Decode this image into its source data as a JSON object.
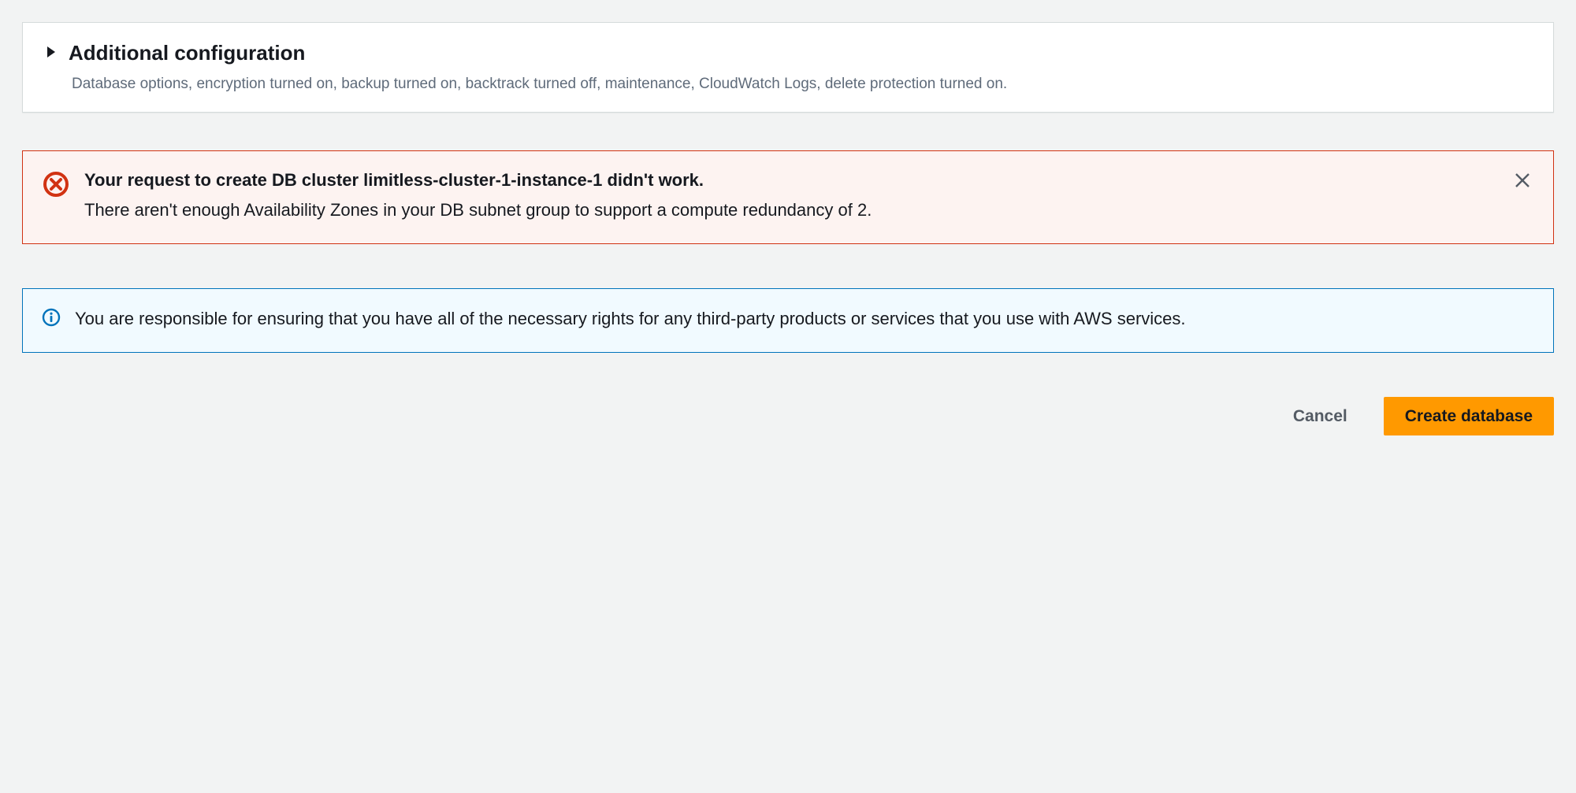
{
  "additional_config": {
    "title": "Additional configuration",
    "subtitle": "Database options, encryption turned on, backup turned on, backtrack turned off, maintenance, CloudWatch Logs, delete protection turned on."
  },
  "error_alert": {
    "title": "Your request to create DB cluster limitless-cluster-1-instance-1 didn't work.",
    "body": "There aren't enough Availability Zones in your DB subnet group to support a compute redundancy of 2."
  },
  "info_alert": {
    "body": "You are responsible for ensuring that you have all of the necessary rights for any third-party products or services that you use with AWS services."
  },
  "actions": {
    "cancel": "Cancel",
    "create": "Create database"
  }
}
